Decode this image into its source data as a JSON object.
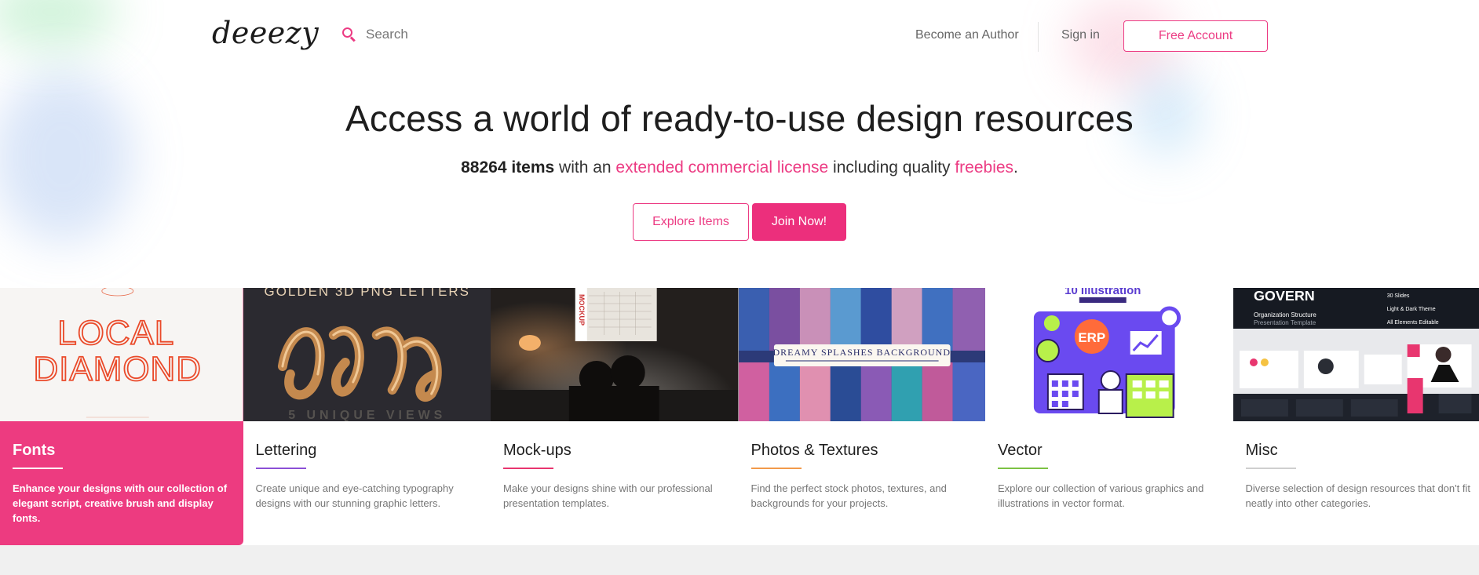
{
  "header": {
    "logo": "deeezy",
    "search_placeholder": "Search",
    "become_author": "Become an Author",
    "sign_in": "Sign in",
    "free_account": "Free Account"
  },
  "hero": {
    "title": "Access a world of ready-to-use design resources",
    "subtitle": {
      "count": "88264 items",
      "part1": " with an ",
      "license_link": "extended commercial license",
      "part2": " including quality ",
      "freebies_link": "freebies",
      "end": "."
    },
    "explore_button": "Explore Items",
    "join_button": "Join Now!"
  },
  "categories": [
    {
      "title": "Fonts",
      "description": "Enhance your designs with our collection of elegant script, creative brush and display fonts.",
      "accent": "#ffffff",
      "active": true,
      "thumb_text": [
        "LOCAL",
        "DIAMOND"
      ]
    },
    {
      "title": "Lettering",
      "description": "Create unique and eye-catching typography designs with our stunning graphic letters.",
      "accent": "#8b4fd6",
      "thumb_text": [
        "GOLDEN 3D PNG LETTERS",
        "5 UNIQUE VIEWS"
      ]
    },
    {
      "title": "Mock-ups",
      "description": "Make your designs shine with our professional presentation templates.",
      "accent": "#e8366f",
      "thumb_text": [
        "MOCKUP"
      ]
    },
    {
      "title": "Photos & Textures",
      "description": "Find the perfect stock photos, textures, and backgrounds for your projects.",
      "accent": "#f29a4a",
      "thumb_text": [
        "DREAMY SPLASHES BACKGROUND"
      ]
    },
    {
      "title": "Vector",
      "description": "Explore our collection of various graphics and illustrations in vector format.",
      "accent": "#7cc243",
      "thumb_text": [
        "10 Illustration",
        "ERP"
      ]
    },
    {
      "title": "Misc",
      "description": "Diverse selection of design resources that don't fit neatly into other categories.",
      "accent": "#cfcfcf",
      "thumb_text": [
        "GOVERN",
        "Organization Structure",
        "Presentation Template",
        "30 Slides",
        "Light & Dark Theme",
        "All Elements Editable"
      ]
    }
  ],
  "colors": {
    "brand_pink": "#ec3b83",
    "active_card": "#ed3b80"
  }
}
